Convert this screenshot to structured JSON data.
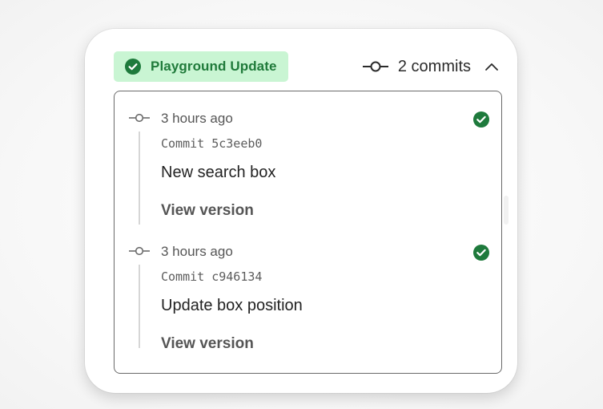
{
  "header": {
    "status_label": "Playground Update",
    "commits_label": "2 commits",
    "icons": {
      "status": "check-circle-icon",
      "commit": "git-commit-icon",
      "toggle": "chevron-up-icon"
    }
  },
  "commits": [
    {
      "time": "3 hours ago",
      "hash": "Commit 5c3eeb0",
      "message": "New search box",
      "link": "View version",
      "status_icon": "check-circle-icon"
    },
    {
      "time": "3 hours ago",
      "hash": "Commit c946134",
      "message": "Update box position",
      "link": "View version",
      "status_icon": "check-circle-icon"
    }
  ],
  "colors": {
    "success_green": "#1e7a3c",
    "pill_background": "#c9f5d3",
    "pill_text": "#1f7a3a"
  }
}
